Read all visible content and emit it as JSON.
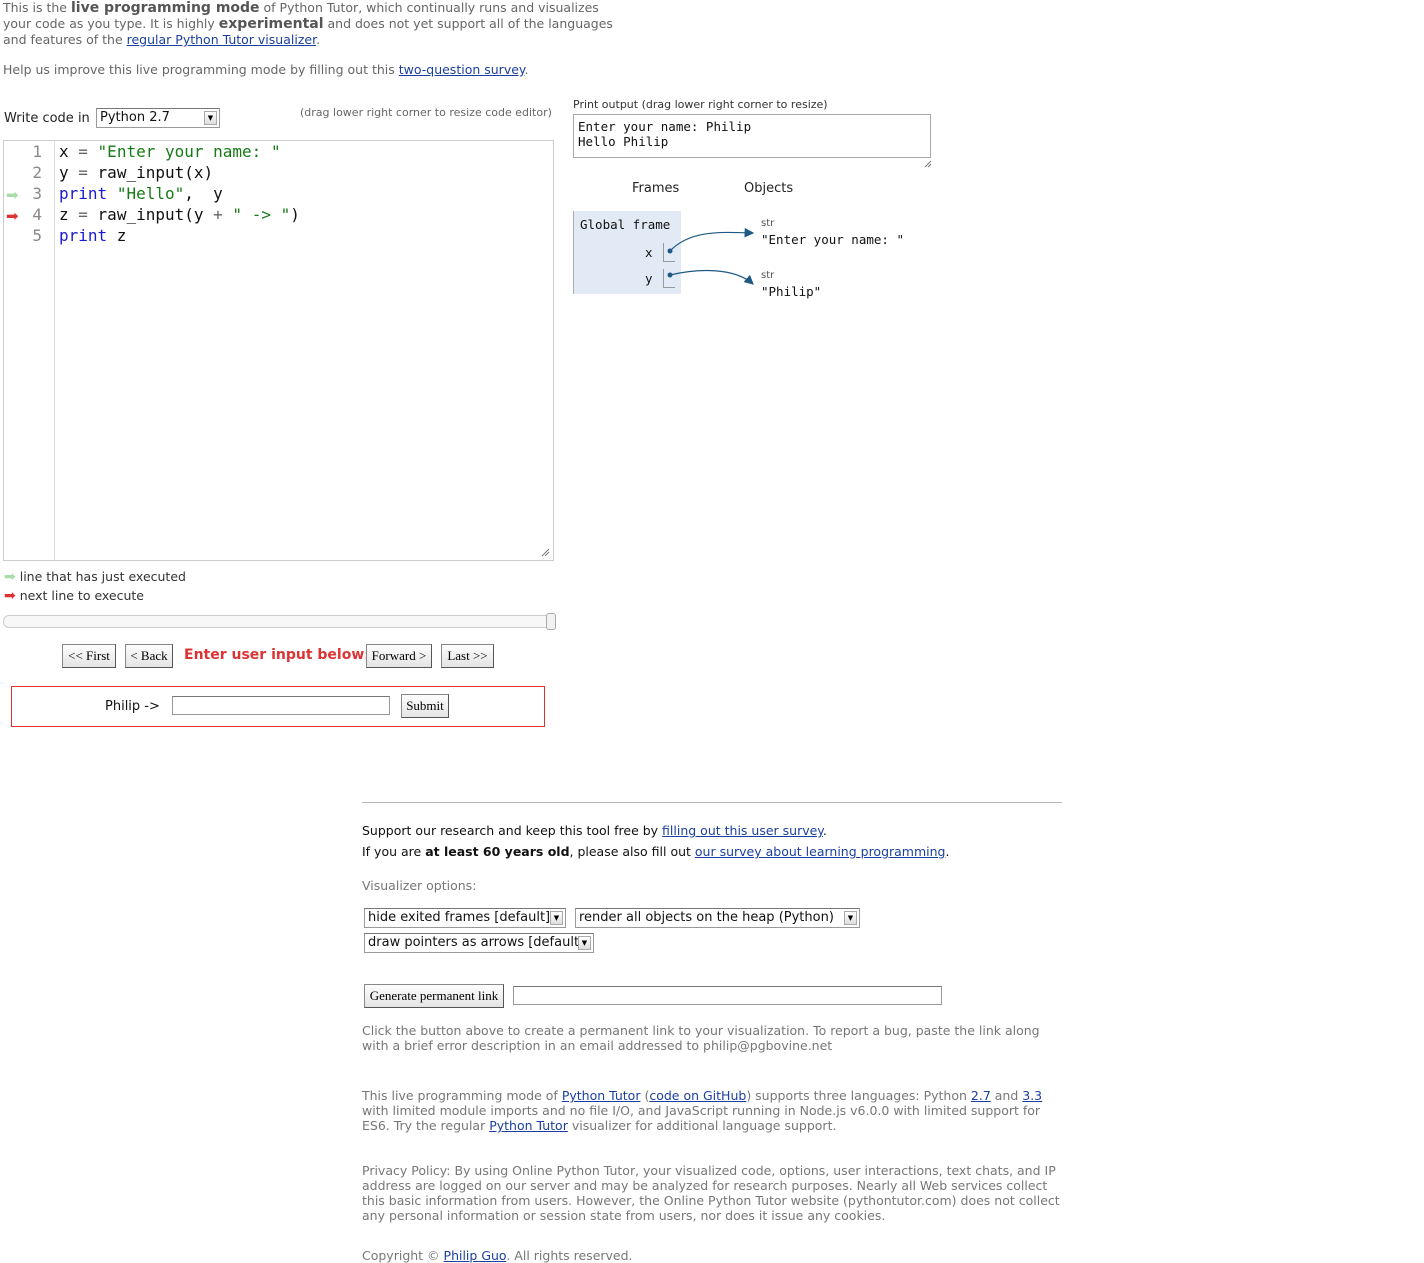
{
  "intro": {
    "p1_a": "This is the ",
    "p1_b": "live programming mode",
    "p1_c": " of Python Tutor, which continually runs and visualizes your code as you type. It is highly ",
    "p1_d": "experimental",
    "p1_e": " and does not yet support all of the languages and features of the ",
    "p1_link": "regular Python Tutor visualizer",
    "p1_end": ".",
    "p2": "Help us improve this live programming mode by filling out this ",
    "p2_link": "two-question survey",
    "p2_end": "."
  },
  "editor": {
    "write_code_label": "Write code in",
    "language": "Python 2.7",
    "drag_note": "(drag lower right corner to resize code editor)",
    "line_numbers": [
      "1",
      "2",
      "3",
      "4",
      "5"
    ],
    "lines": [
      [
        {
          "t": "x"
        },
        {
          "t": " = ",
          "c": "op"
        },
        {
          "t": "\"Enter your name: \"",
          "c": "str"
        }
      ],
      [
        {
          "t": "y"
        },
        {
          "t": " = ",
          "c": "op"
        },
        {
          "t": "raw_input(x)"
        }
      ],
      [
        {
          "t": "print",
          "c": "kw"
        },
        {
          "t": " "
        },
        {
          "t": "\"Hello\"",
          "c": "str"
        },
        {
          "t": ",  y"
        }
      ],
      [
        {
          "t": "z"
        },
        {
          "t": " = ",
          "c": "op"
        },
        {
          "t": "raw_input(y "
        },
        {
          "t": "+",
          "c": "op"
        },
        {
          "t": " "
        },
        {
          "t": "\" -> \"",
          "c": "str"
        },
        {
          "t": ")"
        }
      ],
      [
        {
          "t": "print",
          "c": "kw"
        },
        {
          "t": " z"
        }
      ]
    ],
    "just_executed_line": 3,
    "next_line": 4
  },
  "legend": {
    "executed": "line that has just executed",
    "next": "next line to execute"
  },
  "nav": {
    "first": "<< First",
    "back": "< Back",
    "prompt": "Enter user input below:",
    "forward": "Forward >",
    "last": "Last >>"
  },
  "user_input": {
    "label": "Philip ->",
    "value": "",
    "submit": "Submit"
  },
  "output": {
    "label": "Print output (drag lower right corner to resize)",
    "text": "Enter your name: Philip\nHello Philip"
  },
  "viz": {
    "frames_header": "Frames",
    "objects_header": "Objects",
    "frame_title": "Global frame",
    "vars": [
      "x",
      "y"
    ],
    "objects": [
      {
        "type": "str",
        "value": "\"Enter your name: \""
      },
      {
        "type": "str",
        "value": "\"Philip\""
      }
    ]
  },
  "footer": {
    "support_a": "Support our research and keep this tool free by ",
    "support_link": "filling out this user survey",
    "support_end": ".",
    "age_a": "If you are ",
    "age_b": "at least 60 years old",
    "age_c": ", please also fill out ",
    "age_link": "our survey about learning programming",
    "age_end": ".",
    "options_label": "Visualizer options:",
    "opt_frames": "hide exited frames [default]",
    "opt_heap": "render all objects on the heap (Python)",
    "opt_pointers": "draw pointers as arrows [default]",
    "permalink_button": "Generate permanent link",
    "permalink_value": "",
    "bug_note": "Click the button above to create a permanent link to your visualization. To report a bug, paste the link along with a brief error description in an email addressed to philip@pgbovine.net",
    "about_a": "This live programming mode of ",
    "about_link1": "Python Tutor",
    "about_b": " (",
    "about_link2": "code on GitHub",
    "about_c": ") supports three languages: Python ",
    "about_link3": "2.7",
    "about_d": " and ",
    "about_link4": "3.3",
    "about_e": " with limited module imports and no file I/O, and JavaScript running in Node.js v6.0.0 with limited support for ES6. Try the regular ",
    "about_link5": "Python Tutor",
    "about_f": " visualizer for additional language support.",
    "privacy": "Privacy Policy: By using Online Python Tutor, your visualized code, options, user interactions, text chats, and IP address are logged on our server and may be analyzed for research purposes. Nearly all Web services collect this basic information from users. However, the Online Python Tutor website (pythontutor.com) does not collect any personal information or session state from users, nor does it issue any cookies.",
    "copyright_a": "Copyright © ",
    "copyright_link": "Philip Guo",
    "copyright_b": ". All rights reserved."
  },
  "colors": {
    "executed_arrow": "#a8dca8",
    "next_arrow": "#dd3333",
    "frame_bg": "#e2eaf6",
    "pointer": "#1f5a84",
    "link": "#1a3fa0"
  }
}
